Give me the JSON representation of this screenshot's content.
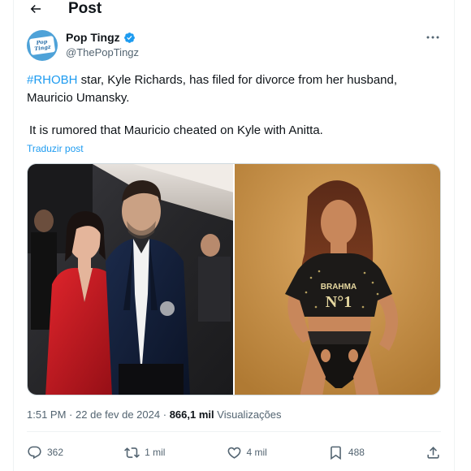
{
  "header": {
    "title": "Post",
    "back_icon": "arrow-left-icon"
  },
  "author": {
    "name": "Pop Tingz",
    "handle": "@ThePopTingz",
    "verified": true,
    "avatar_text": "Pop Tingz",
    "avatar_color": "#4ea2d8"
  },
  "tweet": {
    "hashtag": "#RHOBH",
    "text_rest": " star, Kyle Richards, has filed for divorce from her husband, Mauricio Umansky.",
    "line2": "It is rumored that Mauricio cheated on Kyle with Anitta.",
    "translate_label": "Traduzir post"
  },
  "media": {
    "photos": [
      {
        "name": "photo-kyle-mauricio"
      },
      {
        "name": "photo-anitta",
        "shirt_text_1": "BRAHMA",
        "shirt_text_2": "N°1"
      }
    ]
  },
  "meta": {
    "time": "1:51 PM",
    "sep1": "·",
    "date": "22 de fev de 2024",
    "sep2": "·",
    "views_count": "866,1 mil",
    "views_label": "Visualizações"
  },
  "actions": {
    "replies": "362",
    "reposts": "1 mil",
    "likes": "4 mil",
    "bookmarks": "488"
  },
  "colors": {
    "accent": "#1d9bf0",
    "text": "#0f1419",
    "muted": "#536471",
    "border": "#eff3f4"
  }
}
